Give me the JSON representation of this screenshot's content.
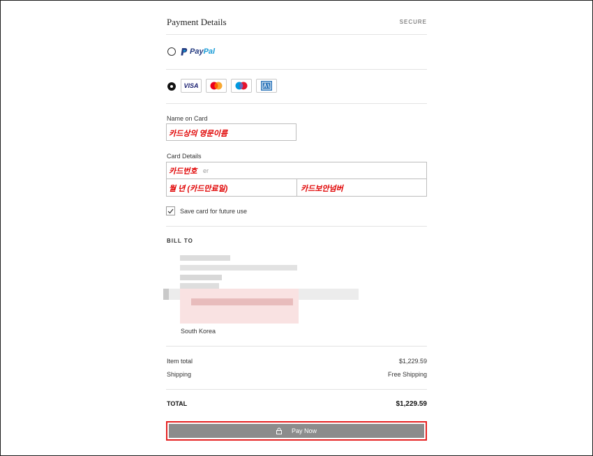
{
  "header": {
    "title": "Payment Details",
    "secure": "SECURE"
  },
  "payment_methods": {
    "paypal": {
      "brand_1": "Pay",
      "brand_2": "Pal",
      "icon": "paypal-logo-icon",
      "selected": false
    },
    "card": {
      "selected": true,
      "brands": [
        {
          "name": "visa",
          "label": "VISA",
          "icon": "visa-logo-icon"
        },
        {
          "name": "mastercard",
          "icon": "mastercard-logo-icon"
        },
        {
          "name": "maestro",
          "icon": "maestro-logo-icon"
        },
        {
          "name": "amex",
          "icon": "amex-logo-icon"
        }
      ]
    }
  },
  "form": {
    "name_label": "Name on Card",
    "name_annotation": "카드상의 영문이름",
    "details_label": "Card Details",
    "card_number_placeholder_visible": "er",
    "card_number_annotation": "카드번호",
    "expiry_annotation": "월 년 (카드만료일)",
    "cvc_annotation": "카드보안넘버",
    "save_card_label": "Save card for future use",
    "save_card_checked": true
  },
  "bill_to": {
    "heading": "BILL TO",
    "country": "South Korea"
  },
  "summary": {
    "item_total_label": "Item total",
    "item_total_value": "$1,229.59",
    "shipping_label": "Shipping",
    "shipping_value": "Free Shipping",
    "total_label": "TOTAL",
    "total_value": "$1,229.59"
  },
  "pay_button": {
    "label": "Pay Now",
    "icon": "lock-icon"
  },
  "colors": {
    "annotation": "#e00000",
    "highlight_border": "#e52020",
    "button_bg": "#8c8c8c",
    "paypal_dark": "#253b80",
    "paypal_light": "#179bd7",
    "visa_blue": "#1a1f71",
    "amex_blue": "#2e77bb"
  }
}
